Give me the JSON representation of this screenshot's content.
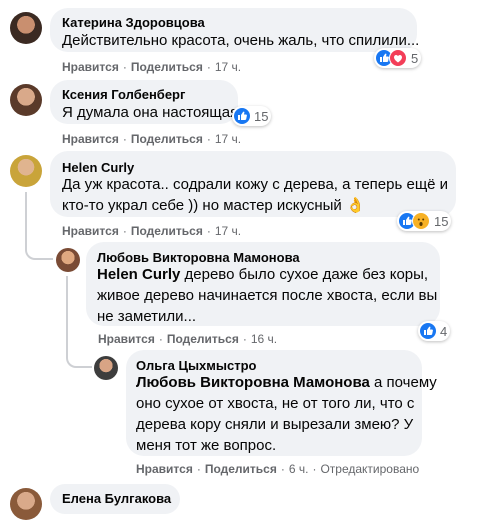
{
  "comments": [
    {
      "author": "Катерина Здоровцова",
      "lines": [
        "Действительно красота, очень жаль, что спилили..."
      ],
      "actions": {
        "like": "Нравится",
        "reply": "Поделиться",
        "time": "17 ч."
      },
      "reactions": {
        "icons": [
          "like-icon",
          "love-icon"
        ],
        "count": "5"
      }
    },
    {
      "author": "Ксения Голбенберг",
      "lines": [
        "Я думала она настоящая"
      ],
      "actions": {
        "like": "Нравится",
        "reply": "Поделиться",
        "time": "17 ч."
      },
      "reactions": {
        "icons": [
          "like-icon"
        ],
        "count": "15"
      }
    },
    {
      "author": "Helen Curly",
      "lines": [
        "Да уж красота.. содрали кожу с дерева, а теперь ещё и",
        "кто-то украл себе )) но мастер искусный 👌"
      ],
      "actions": {
        "like": "Нравится",
        "reply": "Поделиться",
        "time": "17 ч."
      },
      "reactions": {
        "icons": [
          "like-icon",
          "wow-icon"
        ],
        "count": "15"
      }
    },
    {
      "author": "Любовь Викторовна Мамонова",
      "mention": "Helen Curly",
      "lines": [
        " дерево было сухое даже без коры,",
        "живое дерево начинается после хвоста, если вы",
        "не заметили..."
      ],
      "actions": {
        "like": "Нравится",
        "reply": "Поделиться",
        "time": "16 ч."
      },
      "reactions": {
        "icons": [
          "like-icon"
        ],
        "count": "4"
      }
    },
    {
      "author": "Ольга Цыхмыстро",
      "mention": "Любовь Викторовна Мамонова",
      "lines": [
        " а почему",
        "оно сухое от хвоста, не от того ли, что с",
        "дерева кору сняли и вырезали змею? У",
        "меня тот же вопрос."
      ],
      "actions": {
        "like": "Нравится",
        "reply": "Поделиться",
        "time": "6 ч.",
        "edited": "Отредактировано"
      }
    },
    {
      "author": "Елена Булгакова"
    }
  ],
  "colors": {
    "bubble": "#f0f2f5",
    "action_text": "#65676b",
    "like": "#1877f2",
    "love": "#f33e58",
    "wow": "#f7b125",
    "thread_line": "#ced0d4"
  }
}
